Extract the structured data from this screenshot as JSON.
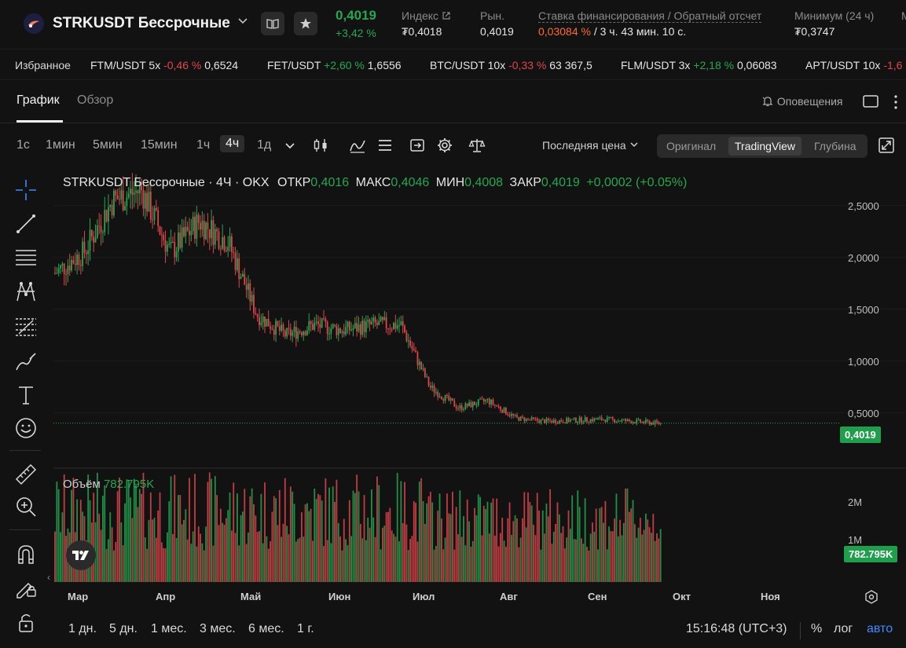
{
  "header": {
    "title": "STRKUSDT Бессрочные",
    "last_price": "0,4019",
    "change": "+3,42 %",
    "index_label": "Индекс",
    "index_value": "₮0,4018",
    "market_label": "Рын.",
    "market_value": "0,4019",
    "funding_label": "Ставка финансирования / Обратный отсчет",
    "funding_rate": "0,03084 %",
    "funding_countdown": " / 3 ч. 43 мин. 10 с.",
    "min_label": "Минимум (24 ч)",
    "min_value": "₮0,3747",
    "max_label_cut": "M"
  },
  "favorites": {
    "label": "Избранное",
    "items": [
      {
        "pair": "FTM/USDT 5x",
        "change": "-0,46 %",
        "price": "0,6524",
        "dir": "down"
      },
      {
        "pair": "FET/USDT",
        "change": "+2,60 %",
        "price": "1,6556",
        "dir": "up"
      },
      {
        "pair": "BTC/USDT 10x",
        "change": "-0,33 %",
        "price": "63 367,5",
        "dir": "down"
      },
      {
        "pair": "FLM/USDT 3x",
        "change": "+2,18 %",
        "price": "0,06083",
        "dir": "up"
      },
      {
        "pair": "APT/USDT 10x",
        "change": "-1,6",
        "price": "",
        "dir": "down"
      }
    ]
  },
  "tabs": {
    "chart": "График",
    "overview": "Обзор",
    "alerts": "Оповещения"
  },
  "toolbar": {
    "timeframes": [
      "1с",
      "1мин",
      "5мин",
      "15мин",
      "1ч",
      "4ч",
      "1д"
    ],
    "active_timeframe": "4ч",
    "price_type": "Последняя цена",
    "views": [
      "Оригинал",
      "TradingView",
      "Глубина"
    ],
    "active_view": "TradingView"
  },
  "legend": {
    "symbol": "STRKUSDT Бессрочные · 4Ч · OKX",
    "open_label": "ОТКР",
    "open": "0,4016",
    "high_label": "МАКС",
    "high": "0,4046",
    "low_label": "МИН",
    "low": "0,4008",
    "close_label": "ЗАКР",
    "close": "0,4019",
    "change": "+0,0002 (+0.05%)"
  },
  "volume": {
    "label": "Объём",
    "value": "782.795K",
    "tag": "782.795K",
    "axis": [
      "2M",
      "1M"
    ]
  },
  "price_axis": [
    "2,5000",
    "2,0000",
    "1,5000",
    "1,0000",
    "0,5000"
  ],
  "current_price_tag": "0,4019",
  "time_axis": [
    "Мар",
    "Апр",
    "Май",
    "Июн",
    "Июл",
    "Авг",
    "Сен",
    "Окт",
    "Ноя"
  ],
  "ranges": [
    "1 дн.",
    "5 дн.",
    "1 мес.",
    "3 мес.",
    "6 мес.",
    "1 г."
  ],
  "bottom": {
    "time": "15:16:48 (UTC+3)",
    "percent": "%",
    "log": "лог",
    "auto": "авто"
  },
  "colors": {
    "up": "#25a750",
    "down": "#e0454c",
    "accent": "#ff6a2b",
    "link": "#3d8bff"
  },
  "chart_data": {
    "type": "line",
    "title": "STRKUSDT Бессрочные · 4Ч · OKX",
    "x": [
      "Мар",
      "Мар",
      "Мар",
      "Мар",
      "Апр",
      "Апр",
      "Апр",
      "Май",
      "Май",
      "Май",
      "Июн",
      "Июн",
      "Июн",
      "Июл",
      "Июл",
      "Июл",
      "Авг",
      "Авг",
      "Авг",
      "Сен",
      "Сен",
      "Сен"
    ],
    "series": [
      {
        "values": [
          1.85,
          2.05,
          2.55,
          2.65,
          2.05,
          2.35,
          2.15,
          1.45,
          1.25,
          1.35,
          1.3,
          1.35,
          1.35,
          0.75,
          0.55,
          0.62,
          0.45,
          0.42,
          0.43,
          0.44,
          0.42,
          0.4
        ]
      }
    ],
    "ylim": [
      0.3,
      2.7
    ],
    "xlabel": "",
    "ylabel": ""
  }
}
